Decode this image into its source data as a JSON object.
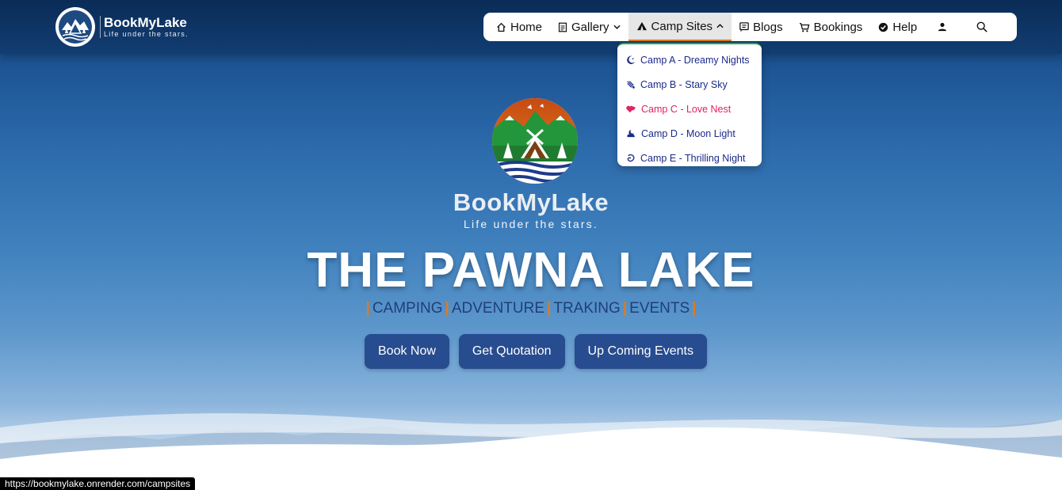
{
  "brand": {
    "name": "BookMyLake",
    "tagline": "Life under the stars."
  },
  "nav": {
    "items": [
      {
        "label": "Home",
        "icon": "home-icon"
      },
      {
        "label": "Gallery",
        "icon": "gallery-icon"
      },
      {
        "label": "Camp Sites",
        "icon": "tent-icon",
        "active": true,
        "expanded": true
      },
      {
        "label": "Blogs",
        "icon": "blog-icon"
      },
      {
        "label": "Bookings",
        "icon": "cart-icon"
      },
      {
        "label": "Help",
        "icon": "check-badge-icon"
      }
    ],
    "user_icon": "user-icon",
    "search_icon": "search-icon"
  },
  "dropdown": {
    "items": [
      {
        "label": "Camp A - Dreamy Nights",
        "icon": "moon-star-icon"
      },
      {
        "label": "Camp B - Stary Sky",
        "icon": "shooting-star-icon"
      },
      {
        "label": "Camp C - Love Nest",
        "icon": "hearts-icon"
      },
      {
        "label": "Camp D - Moon Light",
        "icon": "moon-cloud-icon"
      },
      {
        "label": "Camp E - Thrilling Night",
        "icon": "swirl-icon"
      }
    ]
  },
  "hero": {
    "brand_name": "BookMyLake",
    "brand_tag": "Life under the stars.",
    "headline": "THE PAWNA LAKE",
    "tags": [
      "CAMPING",
      "ADVENTURE",
      "TRAKING",
      "EVENTS"
    ],
    "buttons": [
      "Book Now",
      "Get Quotation",
      "Up Coming Events"
    ]
  },
  "status_url": "https://bookmylake.onrender.com/campsites",
  "colors": {
    "nav_bar": "#0f3a6e",
    "accent": "#e07a1f",
    "button": "#274c8f",
    "dropdown_link": "#1c2a8a",
    "dropdown_highlight": "#e0245e",
    "dropdown_border": "#28a745"
  }
}
